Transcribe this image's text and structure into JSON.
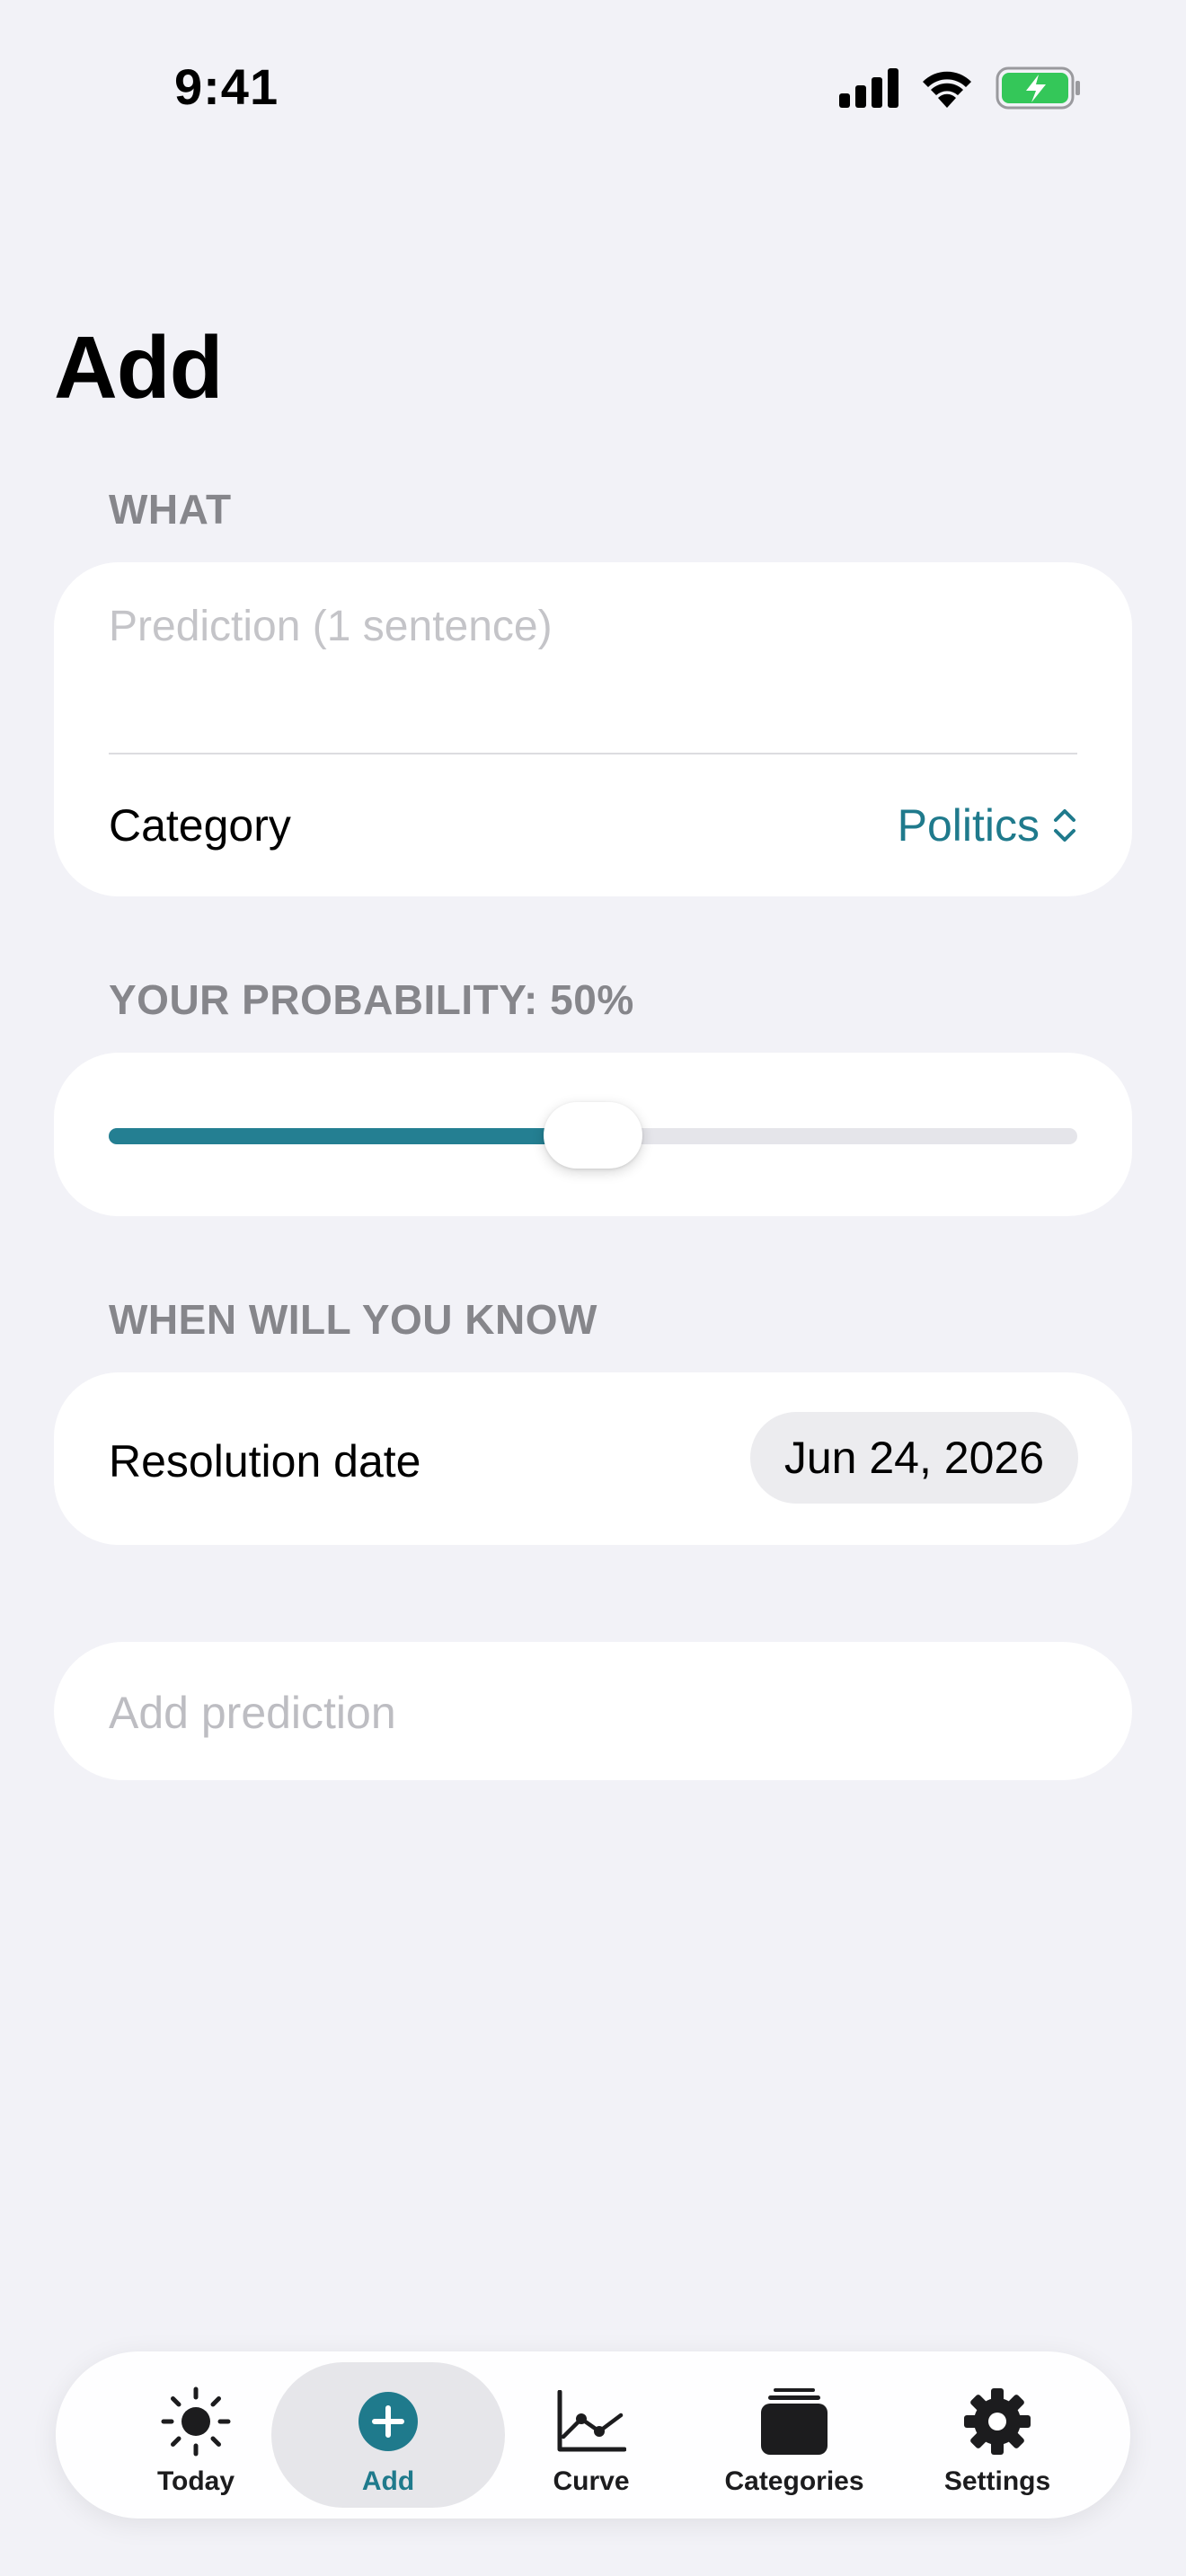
{
  "status_bar": {
    "time": "9:41",
    "icons": [
      "cellular-signal-icon",
      "wifi-icon",
      "battery-charging-icon"
    ]
  },
  "page": {
    "title": "Add"
  },
  "what_section": {
    "header": "WHAT",
    "prediction_placeholder": "Prediction (1 sentence)",
    "prediction_value": "",
    "category_label": "Category",
    "category_value": "Politics"
  },
  "probability_section": {
    "header": "YOUR PROBABILITY: 50%",
    "value": 0.5
  },
  "when_section": {
    "header": "WHEN WILL YOU KNOW",
    "resolution_label": "Resolution date",
    "resolution_value": "Jun 24, 2026"
  },
  "submit": {
    "label": "Add prediction"
  },
  "tab_bar": {
    "tabs": [
      {
        "label": "Today",
        "icon": "sun-icon",
        "active": false
      },
      {
        "label": "Add",
        "icon": "plus-circle-icon",
        "active": true
      },
      {
        "label": "Curve",
        "icon": "line-chart-icon",
        "active": false
      },
      {
        "label": "Categories",
        "icon": "stack-icon",
        "active": false
      },
      {
        "label": "Settings",
        "icon": "gear-icon",
        "active": false
      }
    ]
  },
  "colors": {
    "background": "#f2f2f7",
    "accent": "#1f7a8c",
    "slider_fill": "#247f92",
    "secondary_text": "#86868b",
    "battery_green": "#34c759"
  }
}
